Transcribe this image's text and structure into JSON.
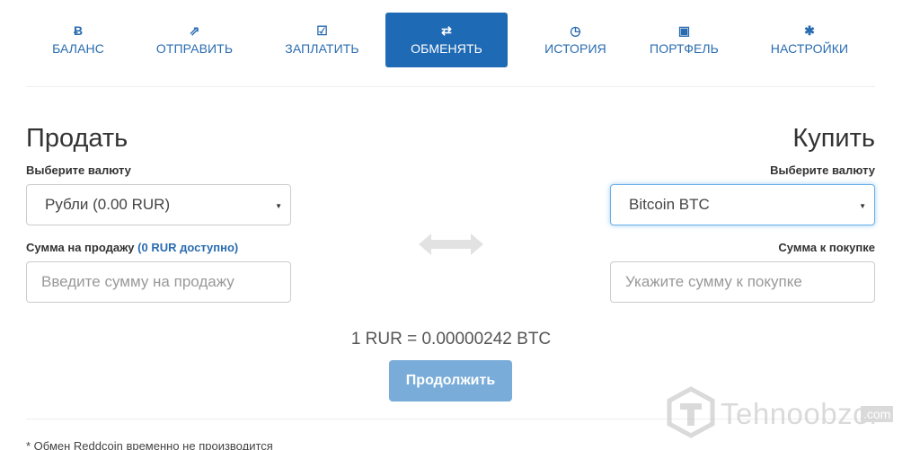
{
  "nav": [
    {
      "icon": "Ƀ",
      "label": "БАЛАНС"
    },
    {
      "icon": "⇗",
      "label": "ОТПРАВИТЬ"
    },
    {
      "icon": "☑",
      "label": "ЗАПЛАТИТЬ"
    },
    {
      "icon": "⇄",
      "label": "ОБМЕНЯТЬ"
    },
    {
      "icon": "◷",
      "label": "ИСТОРИЯ"
    },
    {
      "icon": "▣",
      "label": "ПОРТФЕЛЬ"
    },
    {
      "icon": "✱",
      "label": "НАСТРОЙКИ"
    }
  ],
  "active_tab": "ОБМЕНЯТЬ",
  "sell": {
    "title": "Продать",
    "currency_label": "Выберите валюту",
    "currency_value": "Рубли (0.00 RUR)",
    "amount_label": "Сумма на продажу",
    "available": "(0 RUR доступно)",
    "amount_placeholder": "Введите сумму на продажу"
  },
  "buy": {
    "title": "Купить",
    "currency_label": "Выберите валюту",
    "currency_value": "Bitcoin BTC",
    "amount_label": "Сумма к покупке",
    "amount_placeholder": "Укажите сумму к покупке"
  },
  "rate": "1 RUR = 0.00000242 BTC",
  "continue_label": "Продолжить",
  "note": "* Обмен Reddcoin временно не производится",
  "watermark": {
    "name": "Tehnoobzor",
    "suffix": ".com"
  },
  "colors": {
    "accent": "#1f6ab5",
    "link": "#2a6cb0",
    "button": "#79acd9"
  }
}
